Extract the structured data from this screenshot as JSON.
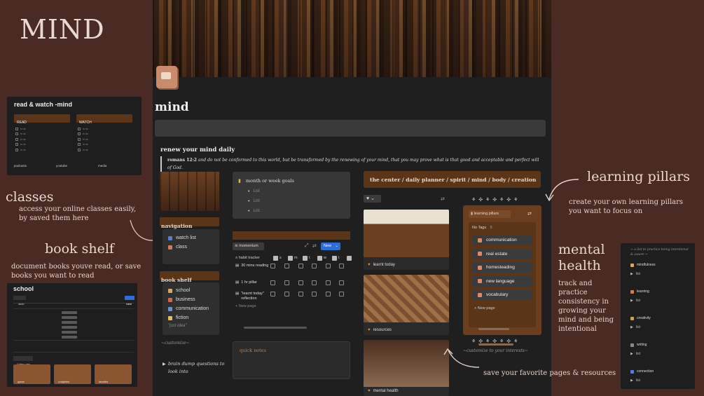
{
  "big_title": "MIND",
  "left": {
    "rw_title": "read & watch -mind",
    "rw_col1": "READ",
    "rw_col2": "WATCH",
    "rw_row": "to do",
    "rw_links": [
      "podcasts",
      "youtube",
      "media"
    ],
    "classes_heading": "classes",
    "classes_desc": "access your online classes easily, by saved them here",
    "bookshelf_heading": "book shelf",
    "bookshelf_desc": "document books youve read, or save books you want to read",
    "school_title": "school",
    "school_tag": "Table",
    "school_new": "New",
    "gallery_label": "Gallery view",
    "gallery_cards": [
      "queue",
      "completed",
      "favorites"
    ]
  },
  "page": {
    "title": "mind",
    "renew_heading": "renew your mind daily",
    "verse_ref": "romans 12:2",
    "verse_text": "and do not be conformed to this world, but be transformed by the renewing of your mind, that you may prove what is that good and acceptable and perfect will of God.",
    "navigation_label": "navigation",
    "nav_items": [
      {
        "label": "watch list",
        "color": "#5a7bd0"
      },
      {
        "label": "class",
        "color": "#d27b5a"
      }
    ],
    "bookshelf_label": "book shelf",
    "shelf_items": [
      {
        "label": "school",
        "color": "#d6a86a"
      },
      {
        "label": "business",
        "color": "#c96a4a"
      },
      {
        "label": "communication",
        "color": "#6a8fd0"
      },
      {
        "label": "fiction",
        "color": "#e0c060"
      }
    ],
    "shelf_idea": "\"just idea\"",
    "customize_left": "~customize~",
    "brain_dump": "brain dump questions to look into",
    "goals_label": "month or week goals",
    "goal_items": [
      "List",
      "List",
      "List"
    ],
    "momentum_label": "momentum",
    "new_button": "New",
    "habit_header": "habit tracker",
    "habit_days": [
      "s",
      "m",
      "t",
      "w",
      "t"
    ],
    "habits": [
      "30 mins reading",
      "1 hr pillar",
      "\"learnt today\" reflection"
    ],
    "new_page": "New page",
    "quick_notes": "quick notes",
    "center_banner": "the center / daily planner / spirit / mind / body / creation",
    "gallery_items": [
      "learnt today",
      "resources",
      "mental health"
    ],
    "pillars_db": "learning pillars",
    "no_tags": "No Tags",
    "no_tags_count": "5",
    "pillars": [
      "communication",
      "real estate",
      "homesteading",
      "new language",
      "vocabulary"
    ],
    "pillars_new": "New page",
    "customize_right": "~customize to your interests~"
  },
  "right": {
    "pillars_heading": "learning pillars",
    "pillars_desc": "create your own learning pillars you want to focus on",
    "mental_heading": "mental health",
    "mental_desc": "track and practice consistency in growing your mind and being intentional",
    "mh_intro": "~ a list to practice being intentional & aware ~",
    "mh_sections": [
      "mindfulness",
      "learning",
      "creativity",
      "writing",
      "connection"
    ],
    "mh_sub": "list",
    "save_note": "save your favorite pages & resources"
  }
}
